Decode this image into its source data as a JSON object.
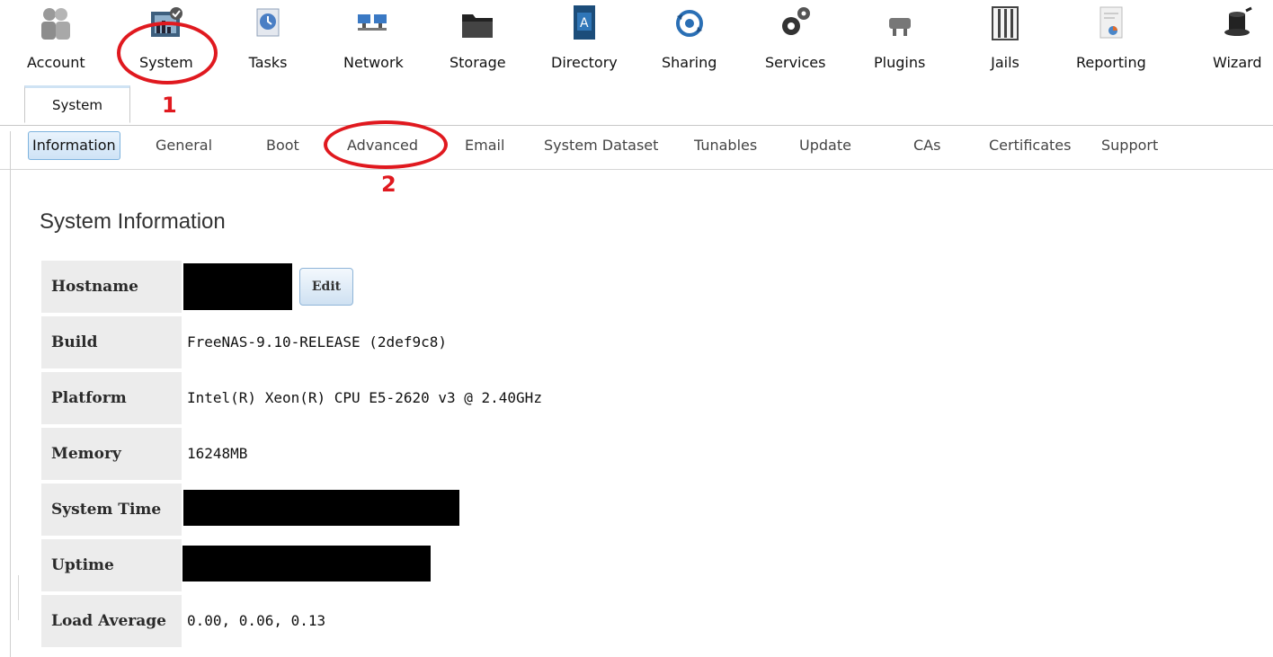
{
  "toolbar": {
    "items": [
      {
        "label": "Account",
        "icon": "account-icon"
      },
      {
        "label": "System",
        "icon": "system-icon"
      },
      {
        "label": "Tasks",
        "icon": "tasks-icon"
      },
      {
        "label": "Network",
        "icon": "network-icon"
      },
      {
        "label": "Storage",
        "icon": "storage-icon"
      },
      {
        "label": "Directory",
        "icon": "directory-icon"
      },
      {
        "label": "Sharing",
        "icon": "sharing-icon"
      },
      {
        "label": "Services",
        "icon": "services-icon"
      },
      {
        "label": "Plugins",
        "icon": "plugins-icon"
      },
      {
        "label": "Jails",
        "icon": "jails-icon"
      },
      {
        "label": "Reporting",
        "icon": "reporting-icon"
      },
      {
        "label": "Wizard",
        "icon": "wizard-icon"
      }
    ]
  },
  "tabs": {
    "active_label": "System"
  },
  "subnav": {
    "items": [
      "Information",
      "General",
      "Boot",
      "Advanced",
      "Email",
      "System Dataset",
      "Tunables",
      "Update",
      "CAs",
      "Certificates",
      "Support"
    ],
    "active": "Information"
  },
  "main": {
    "heading": "System Information",
    "rows": [
      {
        "key": "Hostname",
        "value": ""
      },
      {
        "key": "Build",
        "value": "FreeNAS-9.10-RELEASE (2def9c8)"
      },
      {
        "key": "Platform",
        "value": "Intel(R) Xeon(R) CPU E5-2620 v3 @ 2.40GHz"
      },
      {
        "key": "Memory",
        "value": "16248MB"
      },
      {
        "key": "System Time",
        "value": ""
      },
      {
        "key": "Uptime",
        "value": ""
      },
      {
        "key": "Load Average",
        "value": "0.00, 0.06, 0.13"
      }
    ],
    "edit_label": "Edit"
  },
  "annotations": {
    "step1": "1",
    "step2": "2"
  },
  "colors": {
    "annotation": "#e0191f",
    "active_tab_bg": "#cfe3f6",
    "label_bg": "#ececec"
  }
}
